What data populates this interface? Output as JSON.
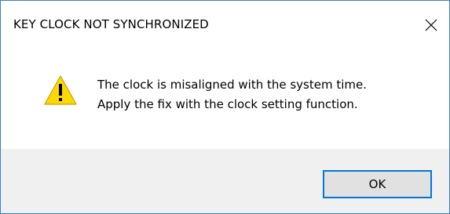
{
  "dialog": {
    "title": "KEY CLOCK NOT SYNCHRONIZED",
    "close_icon": "close-icon",
    "icon": "warning-icon",
    "message_lines": [
      "The clock is misaligned with the system time.",
      "Apply the fix with the clock setting function."
    ],
    "ok_label": "OK"
  },
  "colors": {
    "border": "#3c7fd1",
    "footer_bg": "#f0f0f0",
    "button_border": "#0078d7",
    "button_bg": "#e1e1e1",
    "warning_fill": "#ffd800"
  }
}
